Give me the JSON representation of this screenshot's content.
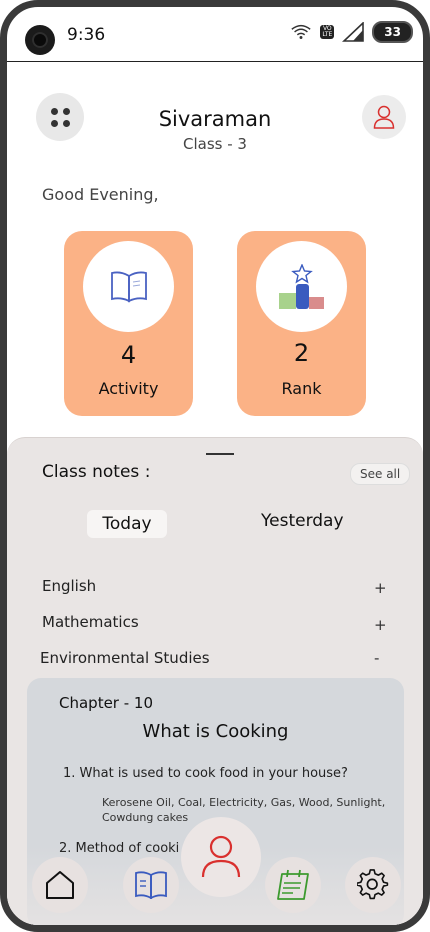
{
  "status_bar": {
    "time": "9:36",
    "network_badge_top": "VO",
    "network_badge_bottom": "LTE",
    "battery": "33"
  },
  "header": {
    "name": "Sivaraman",
    "class": "Class - 3",
    "greeting": "Good Evening,"
  },
  "cards": {
    "activity": {
      "value": "4",
      "label": "Activity",
      "icon": "book-icon"
    },
    "rank": {
      "value": "2",
      "label": "Rank",
      "icon": "podium-icon"
    }
  },
  "notes": {
    "title": "Class notes :",
    "see_all": "See all",
    "tabs": {
      "today": "Today",
      "yesterday": "Yesterday"
    },
    "subjects": [
      {
        "name": "English",
        "toggle": "+"
      },
      {
        "name": "Mathematics",
        "toggle": "+"
      },
      {
        "name": "Environmental Studies",
        "toggle": "-"
      }
    ],
    "chapter": {
      "label": "Chapter - 10",
      "title": "What is Cooking",
      "q1": "1. What is used to cook food in your house?",
      "a1": "Kerosene Oil, Coal, Electricity, Gas, Wood, Sunlight, Cowdung cakes",
      "q2": "2. Method of cooki"
    }
  },
  "nav": {
    "items": [
      "home-icon",
      "book-icon",
      "profile-icon",
      "notes-icon",
      "settings-icon"
    ]
  },
  "colors": {
    "card": "#fbb286",
    "sheet": "#e9e5e4",
    "panel": "#d5d8dc",
    "accent_red": "#d9302e",
    "accent_blue": "#3a5bbf",
    "accent_green": "#3c9a2e"
  }
}
